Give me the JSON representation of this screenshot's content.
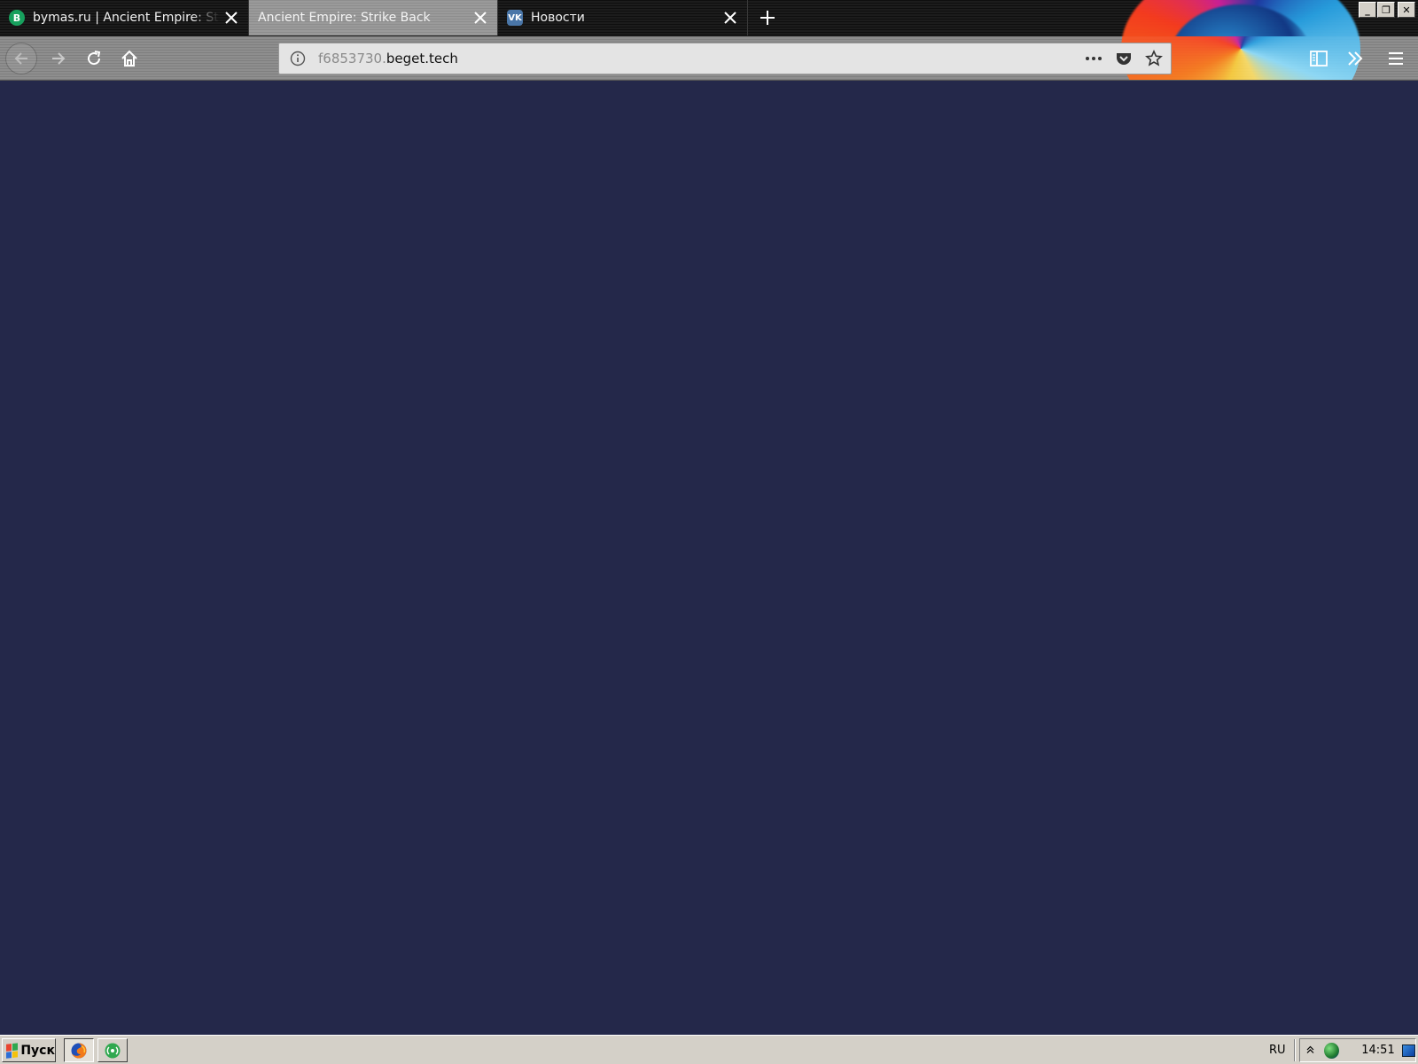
{
  "browser": {
    "tabs": [
      {
        "title": "bymas.ru | Ancient Empire: Strike Back",
        "favicon": "B",
        "favicon_color": "#17a05d",
        "active": false
      },
      {
        "title": "Ancient Empire: Strike Back",
        "favicon": "",
        "active": true
      },
      {
        "title": "Новости",
        "favicon": "VK",
        "favicon_color": "#4a76a8",
        "active": false
      }
    ],
    "new_tab_label": "+",
    "window_controls": {
      "minimize": "_",
      "maximize": "❐",
      "close": "✕"
    },
    "url": {
      "subdomain": "f6853730.",
      "domain": "beget.tech"
    }
  },
  "content": {
    "background": "#24284a"
  },
  "taskbar": {
    "start_label": "Пуск",
    "language": "RU",
    "clock": "14:51"
  }
}
